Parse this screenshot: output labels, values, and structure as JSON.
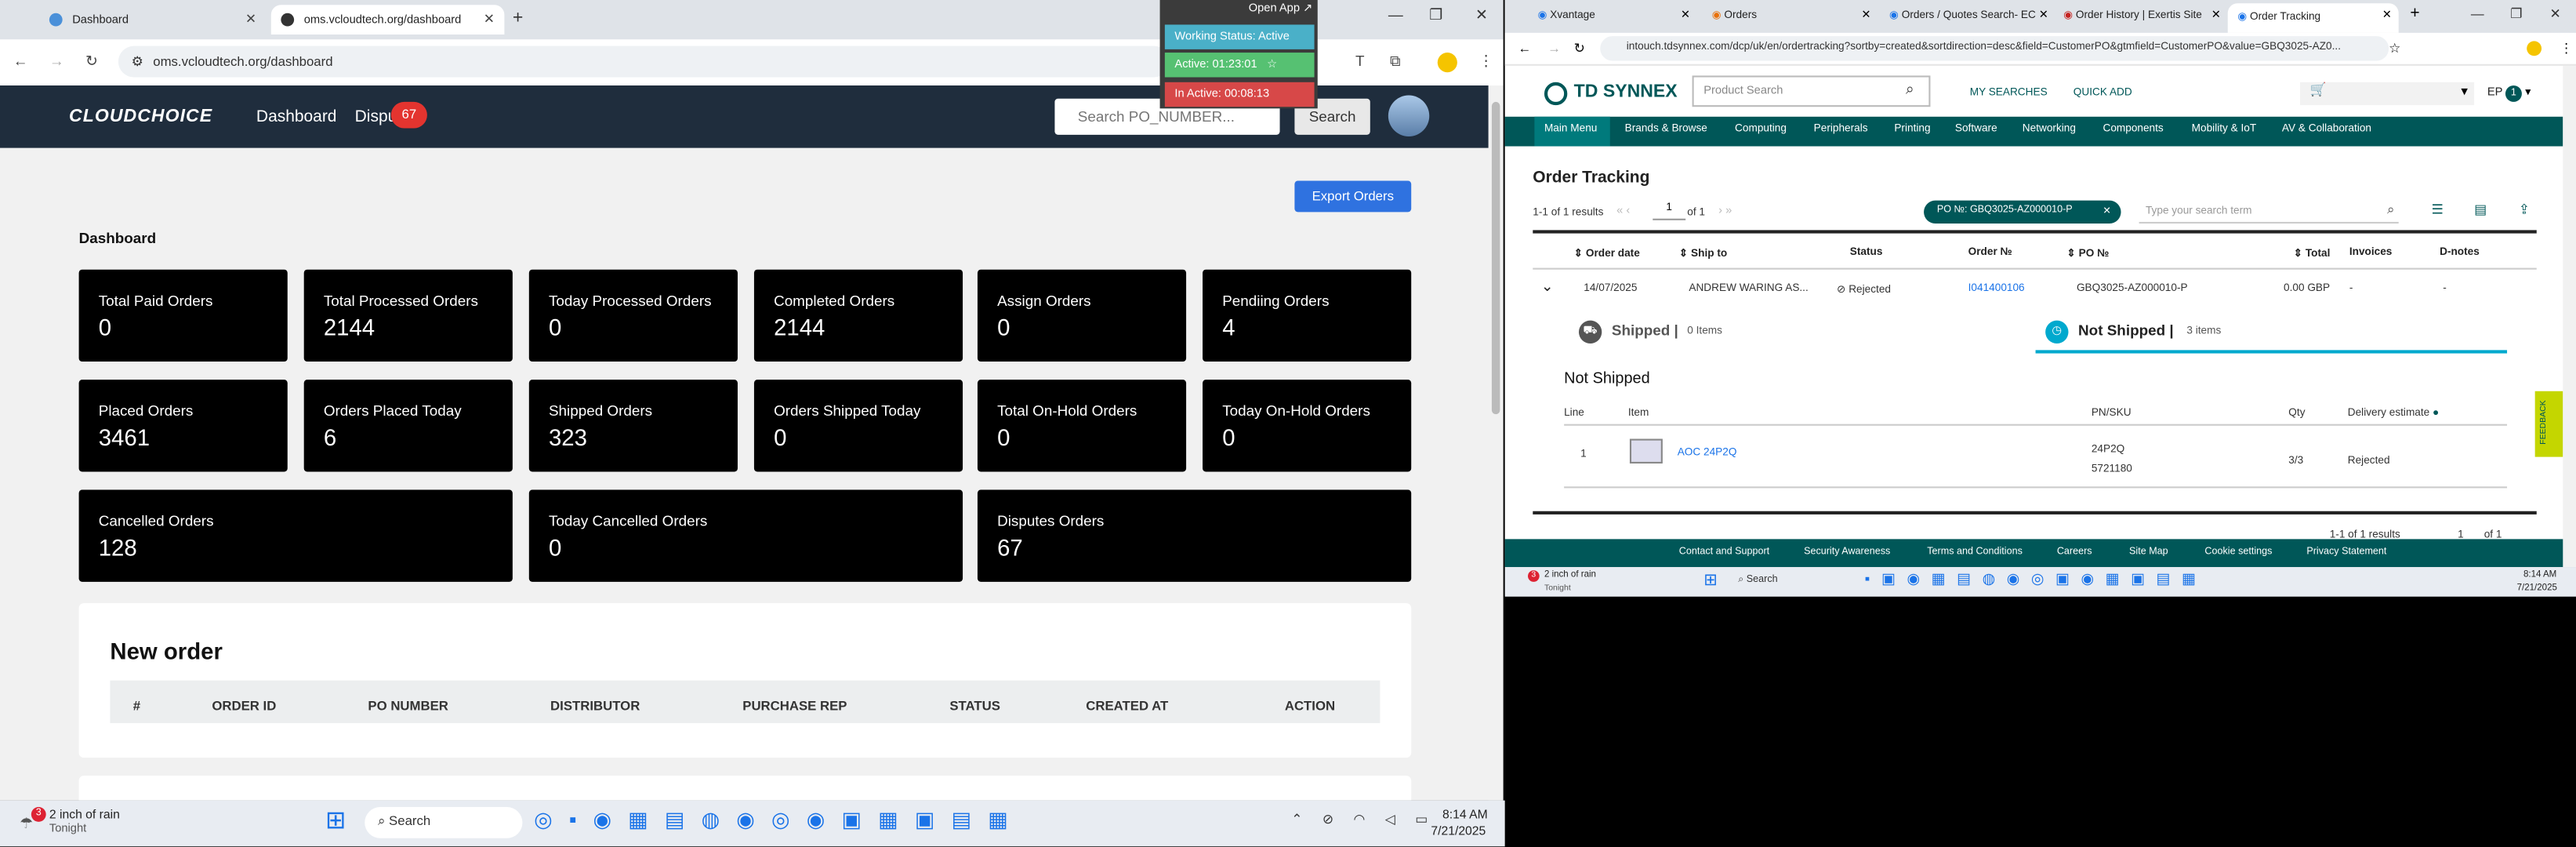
{
  "left_browser": {
    "tabs": [
      {
        "title": "Dashboard",
        "active": false
      },
      {
        "title": "oms.vcloudtech.org/dashboard",
        "active": true
      }
    ],
    "url": "oms.vcloudtech.org/dashboard"
  },
  "oms": {
    "logo": "CLOUDCHOICE",
    "nav": {
      "dashboard": "Dashboard",
      "disputes": "Dispu",
      "disputes_badge": "67"
    },
    "search": {
      "placeholder": "Search PO_NUMBER...",
      "button": "Search"
    },
    "export_button": "Export Orders",
    "section_title": "Dashboard",
    "cards": [
      {
        "label": "Total Paid Orders",
        "value": "0"
      },
      {
        "label": "Total Processed Orders",
        "value": "2144"
      },
      {
        "label": "Today Processed Orders",
        "value": "0"
      },
      {
        "label": "Completed Orders",
        "value": "2144"
      },
      {
        "label": "Assign Orders",
        "value": "0"
      },
      {
        "label": "Pendiing Orders",
        "value": "4"
      },
      {
        "label": "Placed Orders",
        "value": "3461"
      },
      {
        "label": "Orders Placed Today",
        "value": "6"
      },
      {
        "label": "Shipped Orders",
        "value": "323"
      },
      {
        "label": "Orders Shipped Today",
        "value": "0"
      },
      {
        "label": "Total On-Hold Orders",
        "value": "0"
      },
      {
        "label": "Today On-Hold Orders",
        "value": "0"
      },
      {
        "label": "Cancelled Orders",
        "value": "128"
      },
      {
        "label": "Today Cancelled Orders",
        "value": "0"
      },
      {
        "label": "Disputes Orders",
        "value": "67"
      }
    ],
    "new_order": {
      "title": "New order",
      "columns": [
        "#",
        "ORDER ID",
        "PO NUMBER",
        "DISTRIBUTOR",
        "PURCHASE REP",
        "STATUS",
        "CREATED AT",
        "ACTION"
      ]
    }
  },
  "overlay": {
    "open_app": "Open App ↗",
    "working_status": "Working Status: Active",
    "active": "Active: 01:23:01",
    "inactive": "In Active: 00:08:13"
  },
  "right_browser": {
    "tabs": [
      {
        "title": "Xvantage"
      },
      {
        "title": "Orders"
      },
      {
        "title": "Orders / Quotes Search- EC"
      },
      {
        "title": "Order History | Exertis Site"
      },
      {
        "title": "Order Tracking"
      }
    ],
    "url": "intouch.tdsynnex.com/dcp/uk/en/ordertracking?sortby=created&sortdirection=desc&field=CustomerPO&gtmfield=CustomerPO&value=GBQ3025-AZ0..."
  },
  "tds": {
    "logo": "TD SYNNEX",
    "search_placeholder": "Product Search",
    "my_searches": "MY SEARCHES",
    "quick_add": "QUICK ADD",
    "user": "EP",
    "user_badge": "1",
    "nav": [
      "Main Menu",
      "Brands & Browse",
      "Computing",
      "Peripherals",
      "Printing",
      "Software",
      "Networking",
      "Components",
      "Mobility & IoT",
      "AV & Collaboration"
    ],
    "page_title": "Order Tracking",
    "results": "1-1 of 1 results",
    "page_input": "1",
    "page_of": "of 1",
    "filter_chip": "PO №: GBQ3025-AZ000010-P",
    "search_term_placeholder": "Type your search term",
    "table_headers": [
      "Order date",
      "Ship to",
      "Status",
      "Order №",
      "PO №",
      "Total",
      "Invoices",
      "D-notes"
    ],
    "row": {
      "order_date": "14/07/2025",
      "ship_to": "ANDREW WARING AS...",
      "status": "Rejected",
      "order_no": "I041400106",
      "po_no": "GBQ3025-AZ000010-P",
      "total": "0.00 GBP",
      "invoices": "-",
      "dnotes": "-"
    },
    "shipped": {
      "label": "Shipped |",
      "items": "0 Items"
    },
    "not_shipped": {
      "label": "Not Shipped |",
      "items": "3 items"
    },
    "ns_title": "Not Shipped",
    "ns_headers": [
      "Line",
      "Item",
      "PN/SKU",
      "Qty",
      "Delivery estimate"
    ],
    "ns_row": {
      "line": "1",
      "item": "AOC 24P2Q",
      "pn": "24P2Q",
      "sku": "5721180",
      "qty": "3/3",
      "estimate": "Rejected"
    },
    "bottom_results": "1-1 of 1 results",
    "bottom_page": "1",
    "bottom_of": "of 1",
    "feedback": "FEEDBACK",
    "footer": [
      "Contact and Support",
      "Security Awareness",
      "Terms and Conditions",
      "Careers",
      "Site Map",
      "Cookie settings",
      "Privacy Statement"
    ]
  },
  "taskbar_left": {
    "weather_badge": "3",
    "weather": "2 inch of rain",
    "weather_sub": "Tonight",
    "search": "Search",
    "time": "8:14 AM",
    "date": "7/21/2025"
  },
  "taskbar_right": {
    "weather_badge": "3",
    "weather": "2 inch of rain",
    "weather_sub": "Tonight",
    "search": "Search",
    "time": "8:14 AM",
    "date": "7/21/2025"
  },
  "colors": {
    "oms_header": "#1f2d3d",
    "oms_bg": "#f1f1f1",
    "accent_blue": "#2f72e0",
    "tds_teal": "#005758",
    "tds_accent": "#00a9ce",
    "overlay_green": "#56c172",
    "overlay_red": "#d74848"
  }
}
